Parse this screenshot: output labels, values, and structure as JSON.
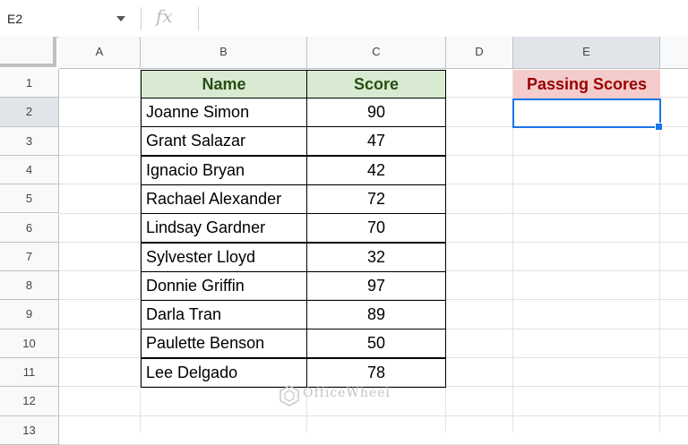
{
  "formula_bar": {
    "cell_ref": "E2",
    "fx": "fx"
  },
  "columns": [
    "A",
    "B",
    "C",
    "D",
    "E"
  ],
  "rows": [
    "1",
    "2",
    "3",
    "4",
    "5",
    "6",
    "7",
    "8",
    "9",
    "10",
    "11",
    "12",
    "13"
  ],
  "table": {
    "headers": {
      "name": "Name",
      "score": "Score"
    },
    "entries": [
      {
        "name": "Joanne Simon",
        "score": "90"
      },
      {
        "name": "Grant Salazar",
        "score": "47"
      },
      {
        "name": "Ignacio Bryan",
        "score": "42"
      },
      {
        "name": "Rachael Alexander",
        "score": "72"
      },
      {
        "name": "Lindsay Gardner",
        "score": "70"
      },
      {
        "name": "Sylvester Lloyd",
        "score": "32"
      },
      {
        "name": "Donnie Griffin",
        "score": "97"
      },
      {
        "name": "Darla Tran",
        "score": "89"
      },
      {
        "name": "Paulette Benson",
        "score": "50"
      },
      {
        "name": "Lee Delgado",
        "score": "78"
      }
    ]
  },
  "passing": {
    "header": "Passing Scores",
    "value": ""
  },
  "watermark": "OfficeWheel",
  "colors": {
    "header_fill": "#d9ead3",
    "header_text": "#274e13",
    "passing_fill": "#f4cccc",
    "passing_text": "#990000",
    "selection": "#1a73e8"
  }
}
